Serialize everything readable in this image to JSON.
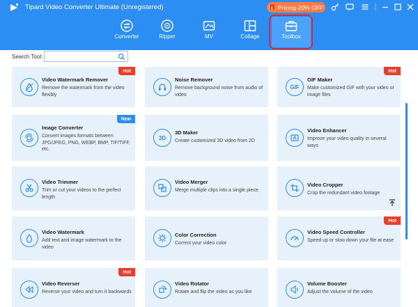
{
  "window": {
    "title": "Tipard Video Converter Ultimate (Unregistered)",
    "promo_label": "Pricing-20% OFF"
  },
  "nav": {
    "items": [
      {
        "label": "Converter"
      },
      {
        "label": "Ripper"
      },
      {
        "label": "MV"
      },
      {
        "label": "Collage"
      },
      {
        "label": "Toolbox"
      }
    ],
    "active": "Toolbox"
  },
  "search": {
    "label": "Search Tool:",
    "value": ""
  },
  "tools": [
    {
      "title": "Video Watermark Remover",
      "desc": "Remove the watermark from the video flexibly",
      "badge": "Hot",
      "icon": "watermark-remover-icon"
    },
    {
      "title": "Noise Remover",
      "desc": "Remove background noise from audio of video",
      "badge": "",
      "icon": "noise-remover-icon"
    },
    {
      "title": "GIF Maker",
      "desc": "Make customized GIF with your video or image files",
      "badge": "Hot",
      "icon": "gif-icon",
      "icon_text": "GIF"
    },
    {
      "title": "Image Converter",
      "desc": "Convert images formats between JPG/JPEG, PNG, WEBP, BMP, TIF/TIFF, etc.",
      "badge": "New",
      "icon": "image-converter-icon"
    },
    {
      "title": "3D Maker",
      "desc": "Create customized 3D video from 2D",
      "badge": "",
      "icon": "3d-icon",
      "icon_text": "3D"
    },
    {
      "title": "Video Enhancer",
      "desc": "Improve your video quality in several ways",
      "badge": "",
      "icon": "enhancer-icon"
    },
    {
      "title": "Video Trimmer",
      "desc": "Trim or cut your videos to the perfect length",
      "badge": "",
      "icon": "scissors-icon"
    },
    {
      "title": "Video Merger",
      "desc": "Merge multiple clips into a single piece",
      "badge": "",
      "icon": "merger-icon"
    },
    {
      "title": "Video Cropper",
      "desc": "Crop the redundant video footage",
      "badge": "",
      "icon": "crop-icon"
    },
    {
      "title": "Video Watermark",
      "desc": "Add text and image watermark to the video",
      "badge": "",
      "icon": "water-drop-icon"
    },
    {
      "title": "Color Correction",
      "desc": "Correct your video color",
      "badge": "",
      "icon": "color-correction-icon"
    },
    {
      "title": "Video Speed Controller",
      "desc": "Speed up or slow down your file at ease",
      "badge": "Hot",
      "icon": "speed-icon"
    },
    {
      "title": "Video Reverser",
      "desc": "Reverse your video and turn it backwards",
      "badge": "Hot",
      "icon": "rewind-icon"
    },
    {
      "title": "Video Rotator",
      "desc": "Rotate and flip the video as you like",
      "badge": "",
      "icon": "rotate-icon"
    },
    {
      "title": "Volume Booster",
      "desc": "Adjust the volume of the video",
      "badge": "",
      "icon": "volume-icon"
    }
  ],
  "colors": {
    "brand_blue": "#2c8ef3",
    "card_bg": "#e6f1fb",
    "hot_badge": "#ee3b2a",
    "new_badge": "#2c8ef3",
    "promo": "#ff7a45",
    "highlight": "#e0272b"
  }
}
